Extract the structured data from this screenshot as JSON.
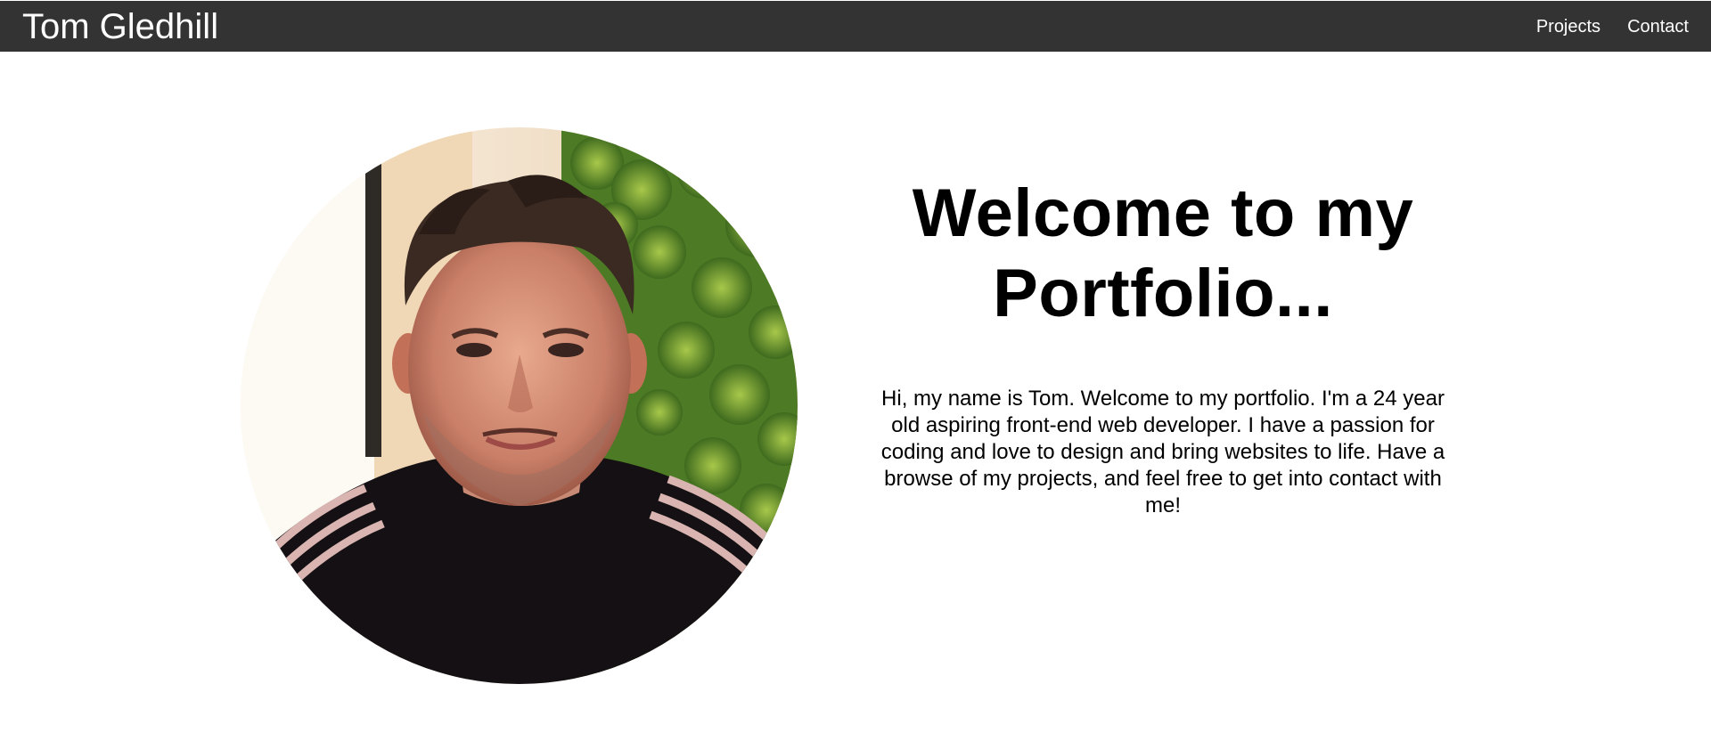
{
  "header": {
    "brand": "Tom Gledhill",
    "nav": [
      {
        "label": "Projects"
      },
      {
        "label": "Contact"
      }
    ]
  },
  "hero": {
    "title": "Welcome to my Portfolio...",
    "intro": "Hi, my name is Tom. Welcome to my portfolio. I'm a 24 year old aspiring front-end web developer. I have a passion for coding and love to design and bring websites to life. Have a browse of my projects, and feel free to get into contact with me!"
  },
  "colors": {
    "navbar_bg": "#333333",
    "navbar_text": "#ffffff",
    "page_bg": "#ffffff",
    "text": "#000000"
  }
}
